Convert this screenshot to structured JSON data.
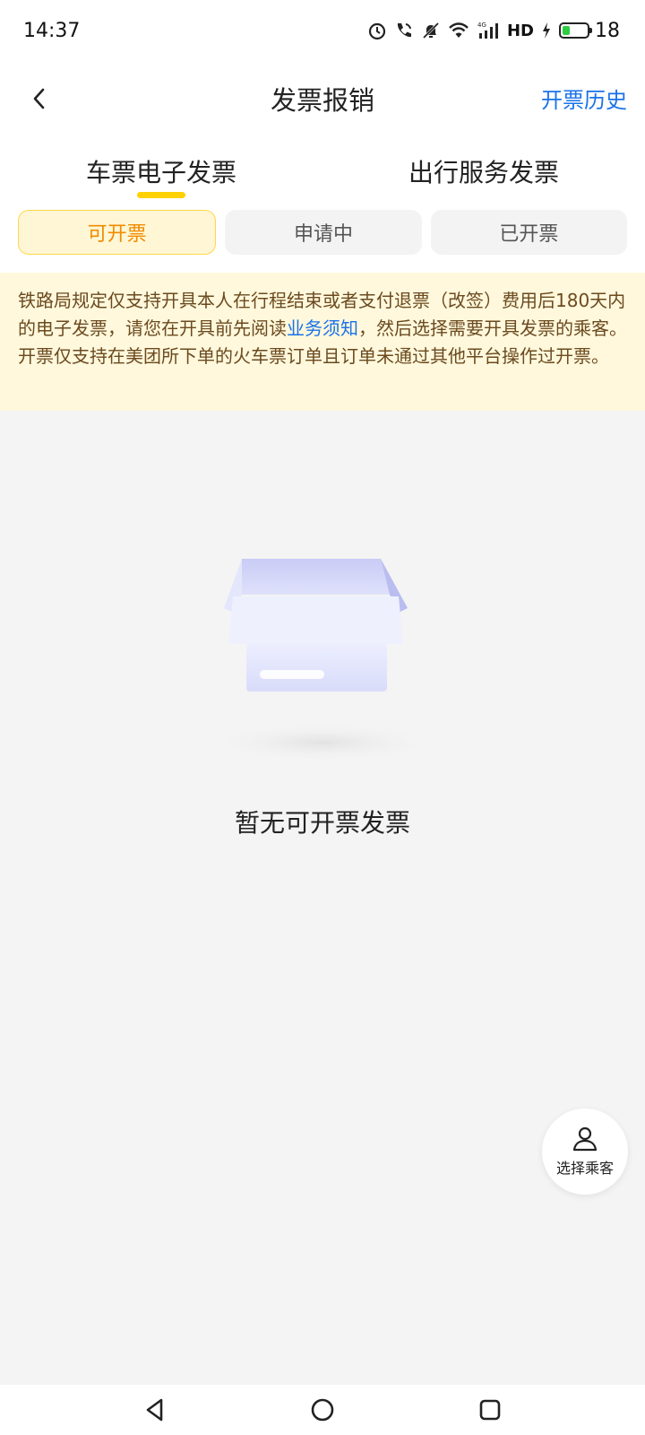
{
  "status_bar": {
    "time": "14:37",
    "network": "HD",
    "battery": "18",
    "icons": [
      "alarm-icon",
      "call-icon",
      "mute-bell-icon",
      "wifi-icon",
      "signal-4g-icon",
      "charging-icon",
      "battery-icon"
    ]
  },
  "nav": {
    "title": "发票报销",
    "right_link": "开票历史",
    "back_icon": "chevron-left-icon"
  },
  "main_tabs": [
    {
      "label": "车票电子发票",
      "active": true
    },
    {
      "label": "出行服务发票",
      "active": false
    }
  ],
  "sub_tabs": [
    {
      "label": "可开票",
      "active": true
    },
    {
      "label": "申请中",
      "active": false
    },
    {
      "label": "已开票",
      "active": false
    }
  ],
  "notice": {
    "text_before": "铁路局规定仅支持开具本人在行程结束或者支付退票（改签）费用后180天内的电子发票，请您在开具前先阅读",
    "link": "业务须知",
    "text_after": "，然后选择需要开具发票的乘客。开票仅支持在美团所下单的火车票订单且订单未通过其他平台操作过开票。"
  },
  "empty_state": {
    "text": "暂无可开票发票",
    "illustration": "empty-box-icon"
  },
  "fab": {
    "label": "选择乘客",
    "icon": "person-icon"
  },
  "colors": {
    "accent_yellow": "#ffd100",
    "active_tab_text": "#f08c00",
    "link_blue": "#1a73e8",
    "notice_bg": "#fff8dc"
  }
}
